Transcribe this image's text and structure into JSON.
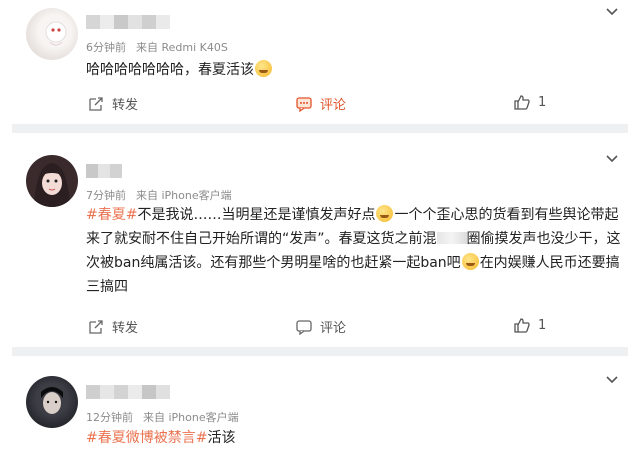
{
  "posts": [
    {
      "time": "6分钟前",
      "source": "来自 Redmi K40S",
      "text_plain": "哈哈哈哈哈哈哈，春夏活该",
      "actions": {
        "forward": "转发",
        "comment": "评论",
        "like_count": "1"
      }
    },
    {
      "time": "7分钟前",
      "source": "来自 iPhone客户端",
      "hashtag": "#春夏#",
      "text_lines": [
        "不是我说……当明星还是谨慎发声好点",
        "一个个歪心思的货看到有些舆论带起",
        "来了就安耐不住自己开始所谓的“发声”。春夏这货之前混",
        "圈偷摸发声也没少干，这",
        "次被ban纯属活该。还有那些个男明星啥的也赶紧一起ban吧",
        "在内娱赚人民币还要搞",
        "三搞四"
      ],
      "actions": {
        "forward": "转发",
        "comment": "评论",
        "like_count": "1"
      }
    },
    {
      "time": "12分钟前",
      "source": "来自 iPhone客户端",
      "hashtag": "#春夏微博被禁言#",
      "text_plain": "活该"
    }
  ],
  "icons": [
    "chevron-down-icon",
    "forward-icon",
    "comment-icon",
    "like-icon",
    "emoji-icon"
  ],
  "colors": {
    "accent": "#eb7350",
    "meta": "#8b8b8b",
    "separator": "#eef0f2"
  }
}
